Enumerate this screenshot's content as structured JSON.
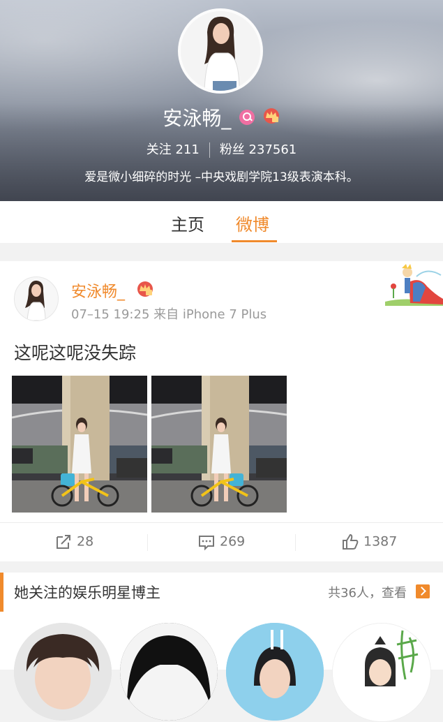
{
  "profile": {
    "name": "安泳畅_",
    "following_label": "关注",
    "following_count": "211",
    "followers_label": "粉丝",
    "followers_count": "237561",
    "bio": "爱是微小细碎的时光 –中央戏剧学院13级表演本科。"
  },
  "tabs": [
    {
      "label": "主页"
    },
    {
      "label": "微博",
      "active": true
    }
  ],
  "post": {
    "author": "安泳畅_",
    "meta": "07–15 19:25 来自 iPhone 7 Plus",
    "text": "这呢这呢没失踪",
    "repost_count": "28",
    "comment_count": "269",
    "like_count": "1387"
  },
  "recommend": {
    "title": "她关注的娱乐明星博主",
    "more": "共36人，查看"
  },
  "colors": {
    "accent": "#f08a2c",
    "vip_badge": "#e8564a",
    "search_badge": "#f06fa2"
  },
  "icons": [
    "search-badge-icon",
    "vip-crown-icon",
    "repost-icon",
    "comment-icon",
    "like-icon",
    "chevron-right-icon"
  ]
}
